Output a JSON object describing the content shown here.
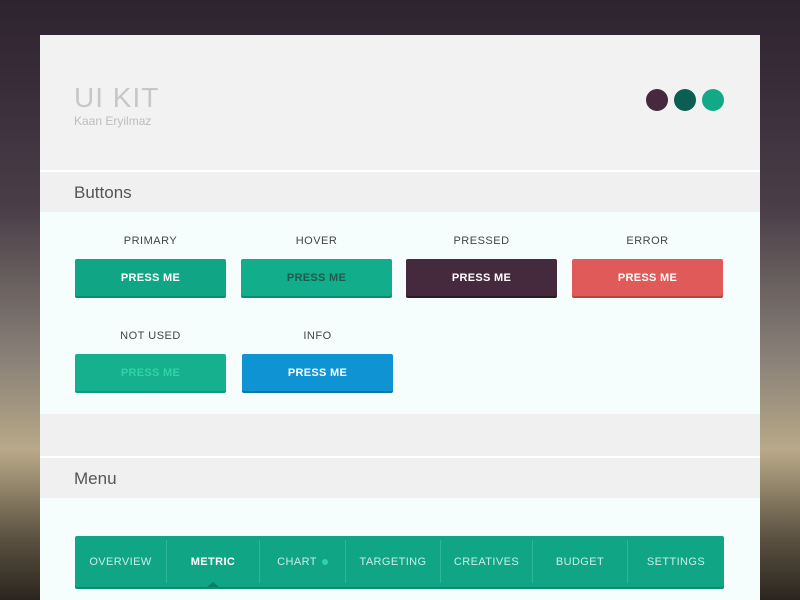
{
  "header": {
    "title": "UI KIT",
    "subtitle": "Kaan Eryilmaz",
    "swatches": [
      "#452a3d",
      "#0d5e52",
      "#12a988"
    ]
  },
  "sections": {
    "buttons_title": "Buttons",
    "menu_title": "Menu"
  },
  "buttons": [
    {
      "label": "PRIMARY",
      "text": "PRESS ME",
      "bg": "#10a585",
      "fg": "#ffffff",
      "shadow": "#0b8c70"
    },
    {
      "label": "HOVER",
      "text": "PRESS ME",
      "bg": "#12ad8b",
      "fg": "#1f5a4e",
      "shadow": "#0b8c70"
    },
    {
      "label": "PRESSED",
      "text": "PRESS ME",
      "bg": "#452a3d",
      "fg": "#ffffff",
      "shadow": "#2a1a26"
    },
    {
      "label": "ERROR",
      "text": "PRESS ME",
      "bg": "#e05a5a",
      "fg": "#ffffff",
      "shadow": "#b84444"
    },
    {
      "label": "NOT USED",
      "text": "PRESS ME",
      "bg": "#17b08e",
      "fg": "#2fd3a6",
      "shadow": "#0f9a7b"
    },
    {
      "label": "INFO",
      "text": "PRESS ME",
      "bg": "#0f93d2",
      "fg": "#ffffff",
      "shadow": "#0b76a8"
    }
  ],
  "menu": {
    "items": [
      {
        "label": "OVERVIEW",
        "active": false,
        "dot": false
      },
      {
        "label": "METRIC",
        "active": true,
        "dot": false
      },
      {
        "label": "CHART",
        "active": false,
        "dot": true
      },
      {
        "label": "TARGETING",
        "active": false,
        "dot": false
      },
      {
        "label": "CREATIVES",
        "active": false,
        "dot": false
      },
      {
        "label": "BUDGET",
        "active": false,
        "dot": false
      },
      {
        "label": "SETTINGS",
        "active": false,
        "dot": false
      }
    ]
  }
}
